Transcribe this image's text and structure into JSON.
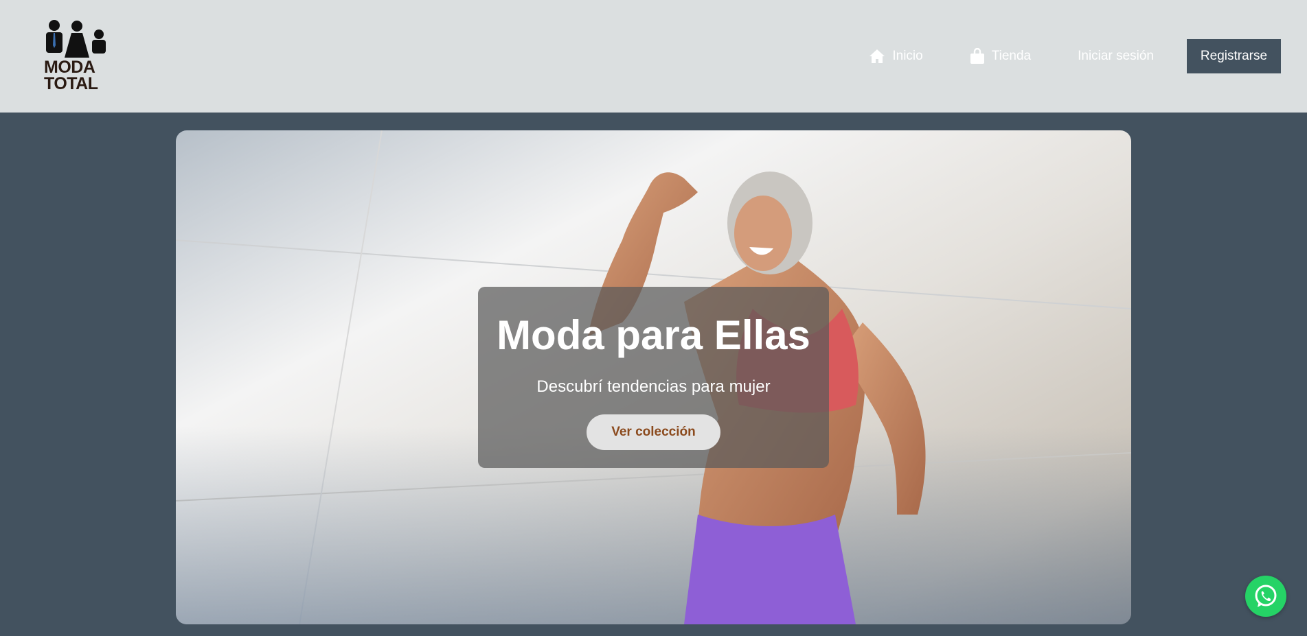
{
  "brand": {
    "logo_line1": "MODA",
    "logo_line2": "TOTAL"
  },
  "nav": {
    "items": [
      {
        "label": "Inicio",
        "icon": "home-icon"
      },
      {
        "label": "Tienda",
        "icon": "shopping-bag-icon"
      },
      {
        "label": "Iniciar sesión"
      }
    ],
    "register_label": "Registrarse"
  },
  "hero": {
    "title": "Moda para Ellas",
    "subtitle": "Descubrí tendencias para mujer",
    "cta_label": "Ver colección"
  },
  "floating": {
    "icon": "whatsapp-icon"
  },
  "colors": {
    "header_bg": "#dbdfe0",
    "page_bg": "#43525f",
    "register_bg": "#43525f",
    "cta_text": "#8b4a1d",
    "whatsapp": "#25d366"
  }
}
